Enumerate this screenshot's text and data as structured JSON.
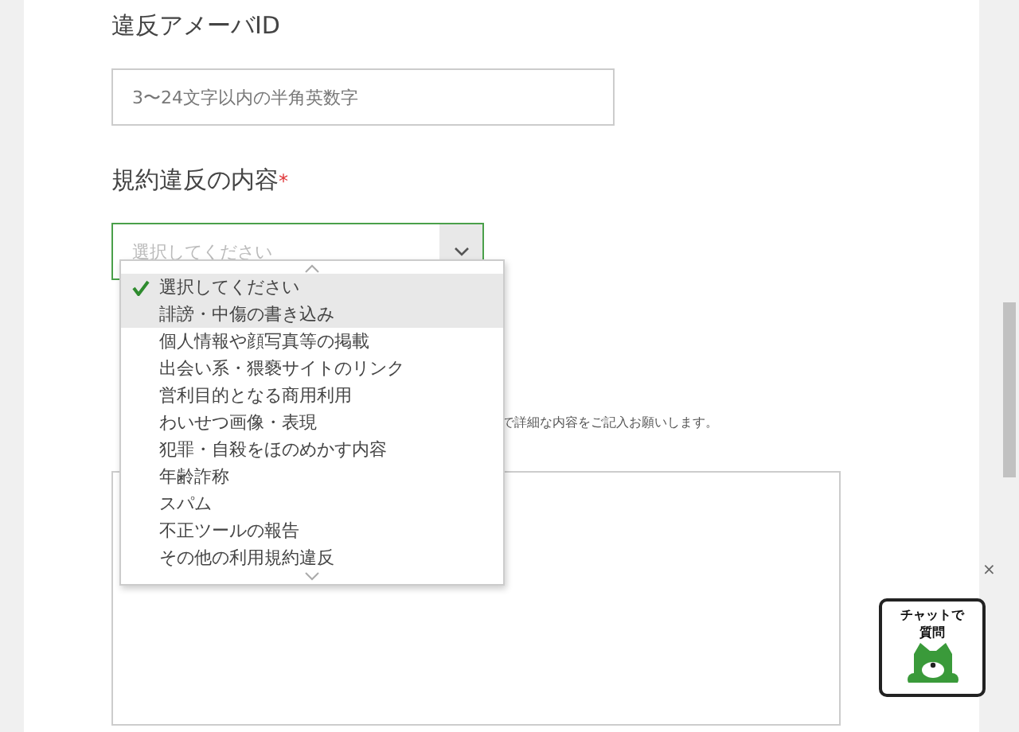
{
  "form": {
    "id_label": "違反アメーバID",
    "id_field": {
      "placeholder": "3〜24文字以内の半角英数字"
    },
    "violation_label": "規約違反の内容",
    "required_mark": "*",
    "violation_select": {
      "value": "選択してください",
      "focused": true,
      "open": true
    },
    "note_tail": "で詳細な内容をご記入お願いします。"
  },
  "dropdown": {
    "options": [
      {
        "label": "選択してください",
        "selected": true,
        "hovered": false
      },
      {
        "label": "誹謗・中傷の書き込み",
        "selected": false,
        "hovered": true
      },
      {
        "label": "個人情報や顔写真等の掲載",
        "selected": false,
        "hovered": false
      },
      {
        "label": "出会い系・猥褻サイトのリンク",
        "selected": false,
        "hovered": false
      },
      {
        "label": "営利目的となる商用利用",
        "selected": false,
        "hovered": false
      },
      {
        "label": "わいせつ画像・表現",
        "selected": false,
        "hovered": false
      },
      {
        "label": "犯罪・自殺をほのめかす内容",
        "selected": false,
        "hovered": false
      },
      {
        "label": "年齢詐称",
        "selected": false,
        "hovered": false
      },
      {
        "label": "スパム",
        "selected": false,
        "hovered": false
      },
      {
        "label": "不正ツールの報告",
        "selected": false,
        "hovered": false
      },
      {
        "label": "その他の利用規約違反",
        "selected": false,
        "hovered": false
      }
    ]
  },
  "chat_widget": {
    "label_line_1": "チャットで",
    "label_line_2": "質問",
    "close": "×"
  }
}
